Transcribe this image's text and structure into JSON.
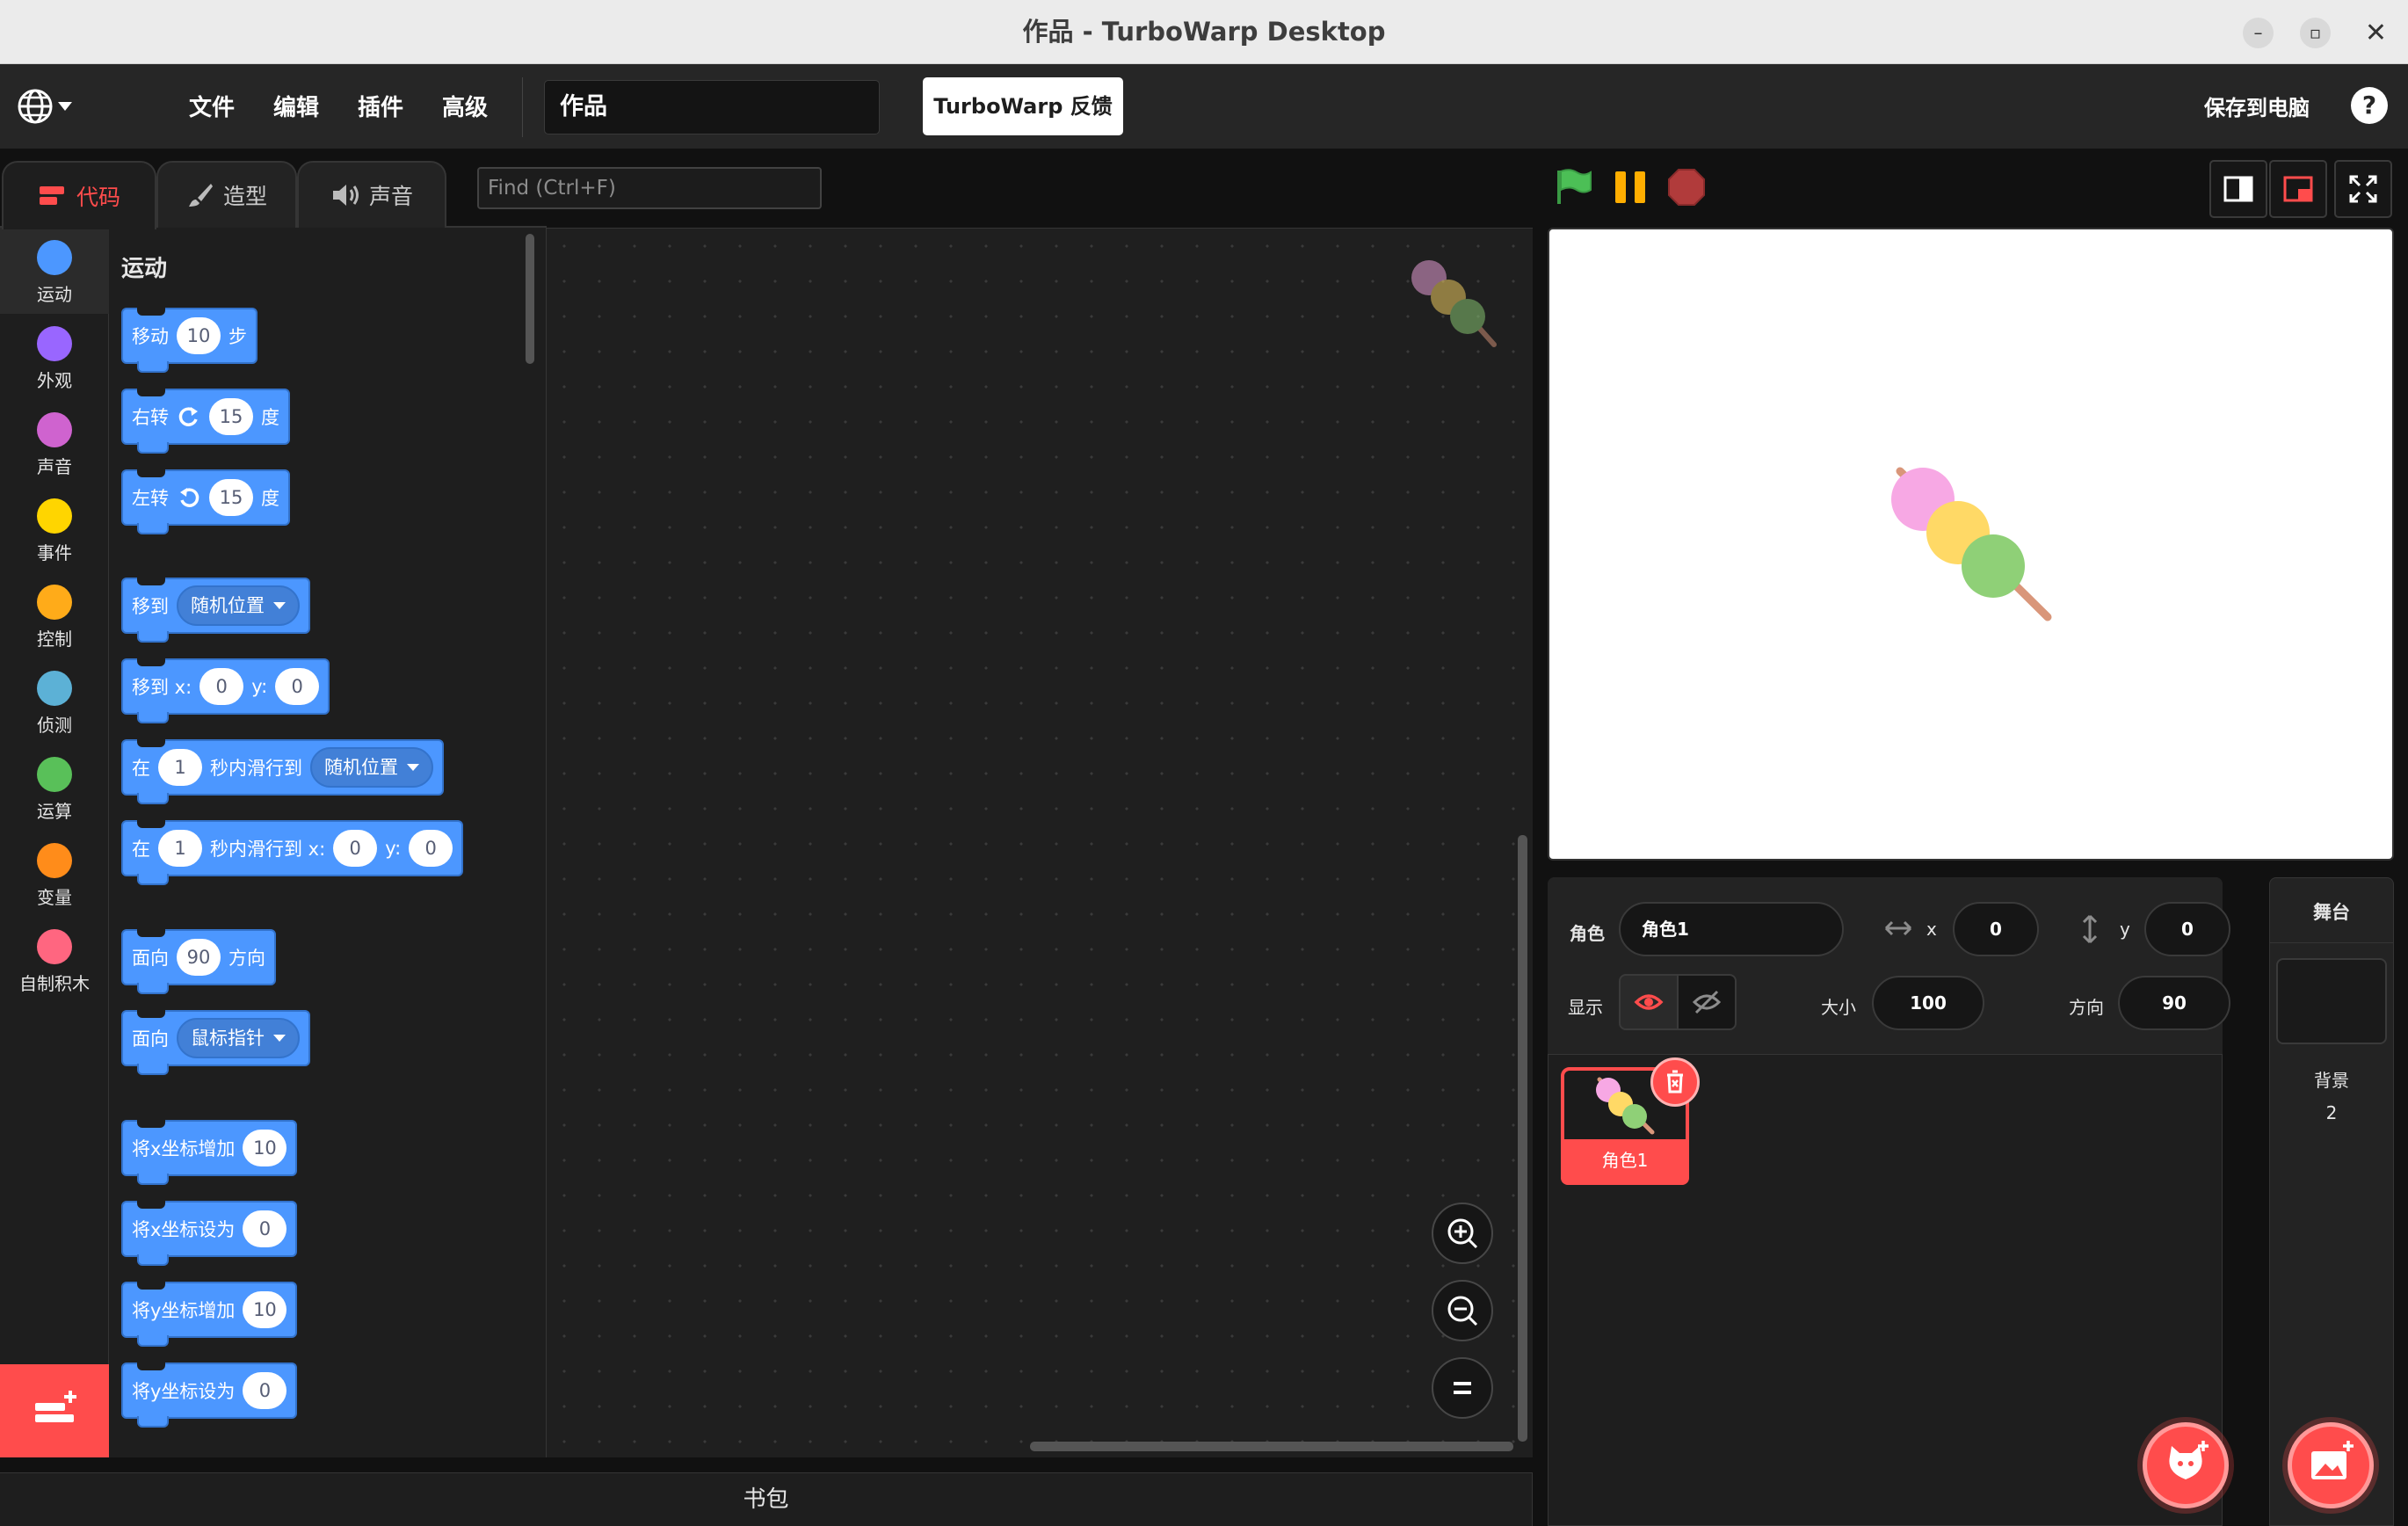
{
  "window": {
    "title": "作品 - TurboWarp Desktop",
    "minimize_glyph": "–",
    "maximize_glyph": "▫",
    "close_glyph": "✕"
  },
  "menu": {
    "file": "文件",
    "edit": "编辑",
    "addons": "插件",
    "advanced": "高级",
    "project_title": "作品",
    "feedback": "TurboWarp 反馈",
    "save": "保存到电脑",
    "help": "?"
  },
  "tabs": {
    "code": "代码",
    "costumes": "造型",
    "sounds": "声音"
  },
  "find": {
    "placeholder": "Find (Ctrl+F)"
  },
  "categories": [
    {
      "label": "运动",
      "color": "#4c97ff"
    },
    {
      "label": "外观",
      "color": "#9966ff"
    },
    {
      "label": "声音",
      "color": "#cf63cf"
    },
    {
      "label": "事件",
      "color": "#ffd500"
    },
    {
      "label": "控制",
      "color": "#ffab19"
    },
    {
      "label": "侦测",
      "color": "#5cb1d6"
    },
    {
      "label": "运算",
      "color": "#59c059"
    },
    {
      "label": "变量",
      "color": "#ff8c1a"
    },
    {
      "label": "自制积木",
      "color": "#ff6680"
    }
  ],
  "palette": {
    "heading": "运动",
    "move": {
      "a": "移动",
      "n": "10",
      "b": "步"
    },
    "turn_right": {
      "a": "右转",
      "n": "15",
      "b": "度"
    },
    "turn_left": {
      "a": "左转",
      "n": "15",
      "b": "度"
    },
    "goto": {
      "a": "移到",
      "menu": "随机位置"
    },
    "goto_xy": {
      "a": "移到 x:",
      "x": "0",
      "y_label": "y:",
      "y": "0"
    },
    "glide": {
      "a": "在",
      "n": "1",
      "b": "秒内滑行到",
      "menu": "随机位置"
    },
    "glide_xy": {
      "a": "在",
      "n": "1",
      "b": "秒内滑行到 x:",
      "x": "0",
      "y_label": "y:",
      "y": "0"
    },
    "point_dir": {
      "a": "面向",
      "n": "90",
      "b": "方向"
    },
    "point_towards": {
      "a": "面向",
      "menu": "鼠标指针"
    },
    "change_x": {
      "a": "将x坐标增加",
      "n": "10"
    },
    "set_x": {
      "a": "将x坐标设为",
      "n": "0"
    },
    "change_y": {
      "a": "将y坐标增加",
      "n": "10"
    },
    "set_y": {
      "a": "将y坐标设为",
      "n": "0"
    }
  },
  "backpack": "书包",
  "sprite_info": {
    "sprite_label": "角色",
    "sprite_name": "角色1",
    "x_label": "x",
    "x": "0",
    "y_label": "y",
    "y": "0",
    "show_label": "显示",
    "size_label": "大小",
    "size": "100",
    "direction_label": "方向",
    "direction": "90"
  },
  "sprites": [
    {
      "name": "角色1"
    }
  ],
  "stage_pane": {
    "title": "舞台",
    "backdrops_label": "背景",
    "backdrops_count": "2"
  },
  "colors": {
    "accent": "#ff4c4c",
    "motion": "#4c97ff",
    "flag": "#4cbf56",
    "pause": "#ffae00",
    "stop": "#b13b3b"
  }
}
